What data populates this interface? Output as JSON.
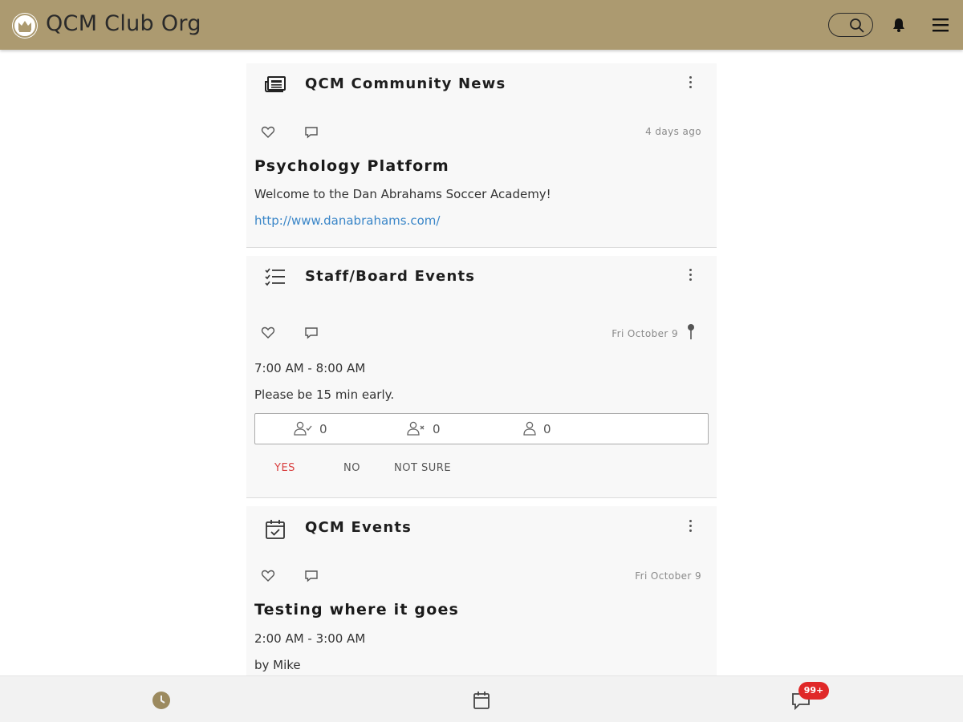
{
  "app": {
    "title": "QCM Club Org"
  },
  "header": {
    "icons": [
      "club-logo-icon",
      "search-icon",
      "bell-icon",
      "hamburger-menu-icon"
    ]
  },
  "colors": {
    "header_bg": "#ac9a70",
    "accent_link": "#3a86c8",
    "yes_red": "#d94040",
    "badge_red": "#e02828"
  },
  "feed": {
    "cards": [
      {
        "icon": "newspaper-icon",
        "title": "QCM Community News",
        "time": "4 days ago",
        "post_title": "Psychology Platform",
        "text": "Welcome to the Dan Abrahams Soccer Academy!",
        "link": "http://www.danabrahams.com/"
      },
      {
        "icon": "checklist-icon",
        "title": "Staff/Board Events",
        "date": "Fri October 9",
        "time_range": "7:00 AM - 8:00 AM",
        "text": "Please be 15 min early.",
        "rsvp": {
          "going": "0",
          "not_going": "0",
          "maybe": "0"
        },
        "buttons": {
          "yes": "YES",
          "no": "NO",
          "not_sure": "NOT SURE"
        }
      },
      {
        "icon": "calendar-check-icon",
        "title": "QCM Events",
        "date": "Fri October 9",
        "post_title": "Testing where it goes",
        "time_range": "2:00 AM - 3:00 AM",
        "author": "by Mike"
      }
    ]
  },
  "bottom_nav": {
    "items": [
      "clock-icon",
      "calendar-icon",
      "chat-icon"
    ],
    "badge": "99+"
  }
}
